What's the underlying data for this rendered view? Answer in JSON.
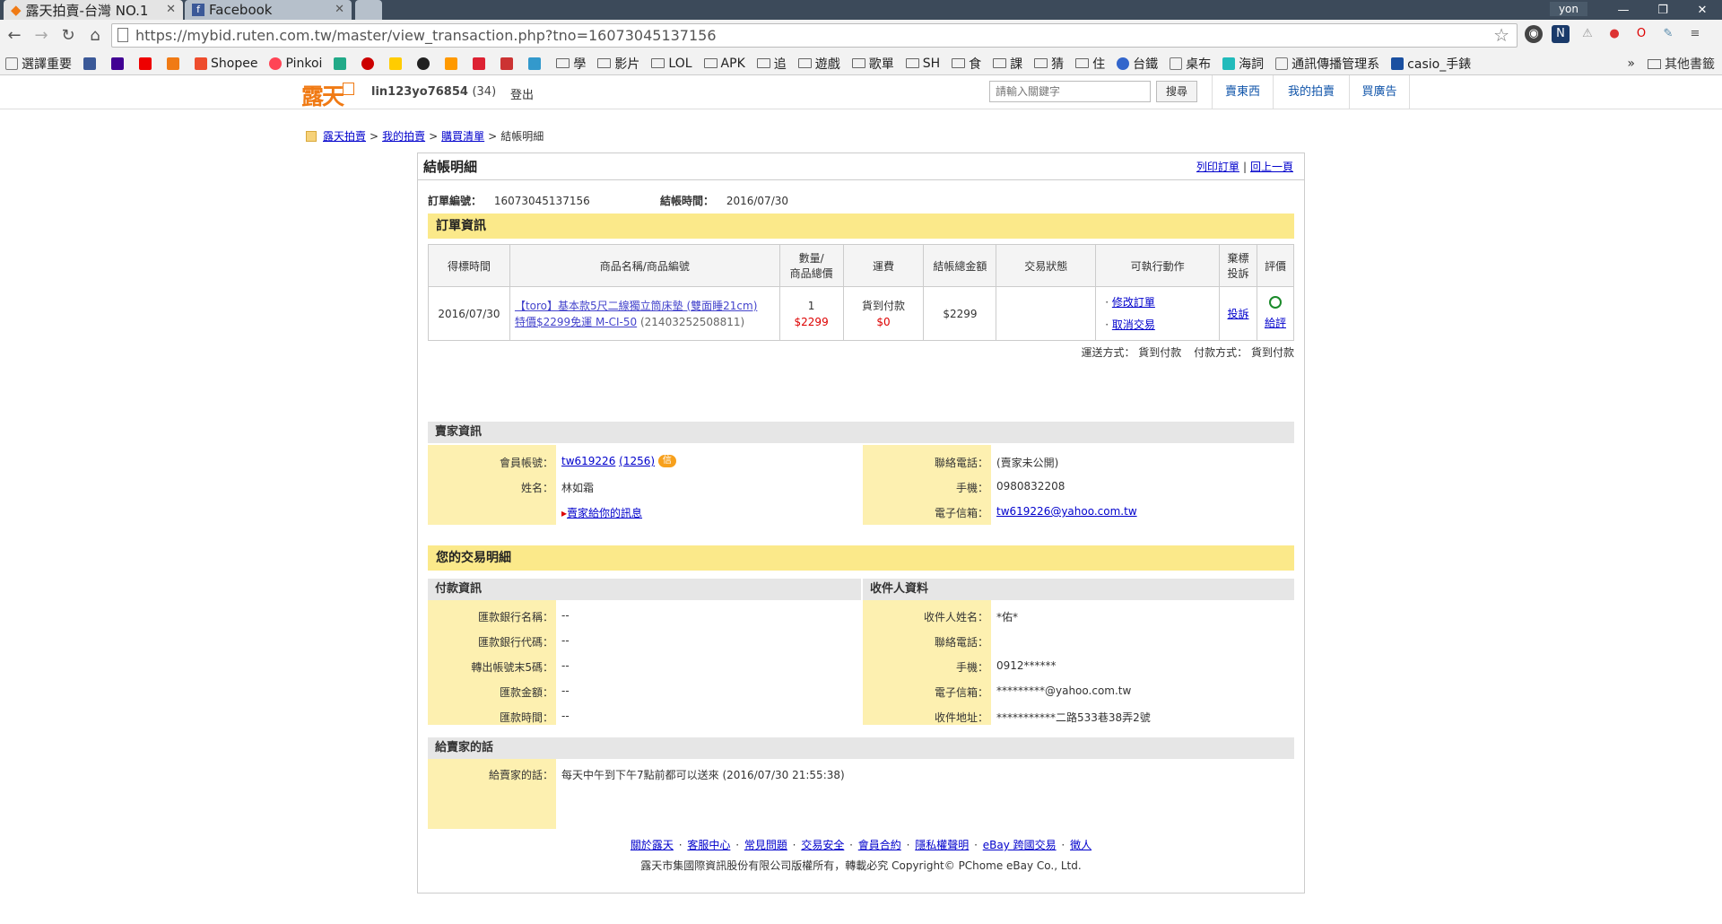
{
  "browser": {
    "tabs": [
      {
        "title": "露天拍賣-台灣 NO.1"
      },
      {
        "title": "Facebook"
      }
    ],
    "user_badge": "yon",
    "url": "https://mybid.ruten.com.tw/master/view_transaction.php?tno=16073045137156",
    "bookmarks": [
      "選譯重要",
      "Shopee",
      "Pinkoi",
      "學",
      "影片",
      "LOL",
      "APK",
      "追",
      "遊戲",
      "歌單",
      "SH",
      "食",
      "課",
      "猜",
      "住",
      "台鐵",
      "桌布",
      "海詞",
      "通訊傳播管理系",
      "casio_手錶"
    ],
    "bookmarks_other": "其他書籤"
  },
  "site": {
    "logo": "露天",
    "username": "lin123yo76854",
    "user_count": "(34)",
    "logout": "登出",
    "search_placeholder": "請輸入關鍵字",
    "search_button": "搜尋",
    "nav": [
      "賣東西",
      "我的拍賣",
      "買廣告"
    ]
  },
  "breadcrumb": [
    "露天拍賣",
    "我的拍賣",
    "購買清單",
    "結帳明細"
  ],
  "page": {
    "title": "結帳明細",
    "print_link": "列印訂單",
    "back_link": "回上一頁",
    "order_no_label": "訂單編號：",
    "order_no": "16073045137156",
    "checkout_time_label": "結帳時間：",
    "checkout_time": "2016/07/30"
  },
  "order_section": {
    "title": "訂單資訊",
    "headers": [
      "得標時間",
      "商品名稱/商品編號",
      "數量/",
      "商品總價",
      "運費",
      "結帳總金額",
      "交易狀態",
      "可執行動作",
      "棄標",
      "投訴",
      "評價"
    ],
    "row": {
      "date": "2016/07/30",
      "product_name_1": "【toro】基本款5尺二線獨立筒床墊 (雙面睡21cm)",
      "product_name_2": "特價$2299免運 M-CI-50",
      "product_id": "(21403252508811)",
      "qty": "1",
      "price": "$2299",
      "shipping_text": "貨到付款",
      "shipping_fee": "$0",
      "total": "$2299",
      "status": "",
      "action_1": "修改訂單",
      "action_2": "取消交易",
      "complaint": "投訴",
      "rate": "給評"
    },
    "ship_method_label": "運送方式：",
    "ship_method": "貨到付款",
    "pay_method_label": "付款方式：",
    "pay_method": "貨到付款"
  },
  "seller_section": {
    "title": "賣家資訊",
    "account_label": "會員帳號：",
    "account": "tw619226",
    "rating": "(1256)",
    "badge": "信",
    "name_label": "姓名：",
    "name": "林如霜",
    "message_link": "賣家給你的訊息",
    "phone_label": "聯絡電話：",
    "phone": "(賣家未公開)",
    "mobile_label": "手機：",
    "mobile": "0980832208",
    "email_label": "電子信箱：",
    "email": "tw619226@yahoo.com.tw"
  },
  "transaction_section": {
    "title": "您的交易明細",
    "pay_header": "付款資訊",
    "recv_header": "收件人資料",
    "pay_rows": [
      {
        "label": "匯款銀行名稱：",
        "value": "--"
      },
      {
        "label": "匯款銀行代碼：",
        "value": "--"
      },
      {
        "label": "轉出帳號末5碼：",
        "value": "--"
      },
      {
        "label": "匯款金額：",
        "value": "--"
      },
      {
        "label": "匯款時間：",
        "value": "--"
      }
    ],
    "recv_rows": [
      {
        "label": "收件人姓名：",
        "value": "*佑*"
      },
      {
        "label": "聯絡電話：",
        "value": ""
      },
      {
        "label": "手機：",
        "value": "0912******"
      },
      {
        "label": "電子信箱：",
        "value": "*********@yahoo.com.tw"
      },
      {
        "label": "收件地址：",
        "value": "***********二路533巷38弄2號"
      }
    ]
  },
  "message_section": {
    "title": "給賣家的話",
    "label": "給賣家的話：",
    "text": "每天中午到下午7點前都可以送來 (2016/07/30 21:55:38)"
  },
  "footer": {
    "links": [
      "關於露天",
      "客服中心",
      "常見問題",
      "交易安全",
      "會員合約",
      "隱私權聲明",
      "eBay 跨國交易",
      "徵人"
    ],
    "copyright": "露天市集國際資訊股份有限公司版權所有，轉載必究 Copyright©   PChome eBay Co., Ltd."
  }
}
